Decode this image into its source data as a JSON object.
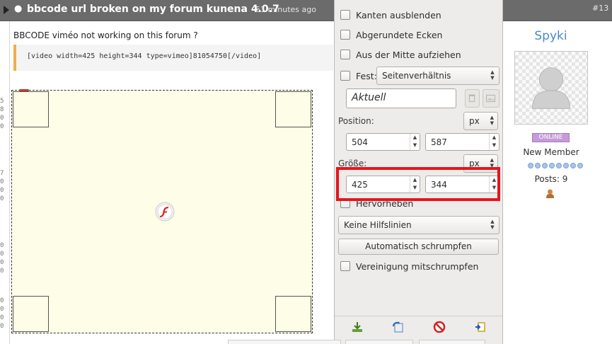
{
  "post": {
    "title": "bbcode url broken on my forum kunena 4.0.7",
    "time": "51 minutes ago",
    "number": "#13",
    "bullet": "●",
    "body": "BBCODE viméo not working on this forum ?",
    "code": "[video width=425 height=344 type=vimeo]81054750[/video]"
  },
  "gutter": {
    "ticks": [
      "5",
      "8",
      "0",
      "0",
      "7",
      "0",
      "0",
      "0",
      "0",
      "0",
      "0",
      "0",
      "0",
      "0",
      "0",
      "0"
    ]
  },
  "flash_box": {
    "close_glyph": "×"
  },
  "panel": {
    "checkboxes": [
      {
        "label": "Kanten ausblenden",
        "checked": false
      },
      {
        "label": "Abgerundete Ecken",
        "checked": false
      },
      {
        "label": "Aus der Mitte aufziehen",
        "checked": false
      }
    ],
    "fixed_label": "Fest:",
    "fixed_select": "Seitenverhältnis",
    "name_value": "Aktuell",
    "position_label": "Position:",
    "position_unit": "px",
    "position_x": "504",
    "position_y": "587",
    "size_label": "Größe:",
    "size_unit": "px",
    "size_w": "425",
    "size_h": "344",
    "highlight_label": "Hervorheben",
    "guides_select": "Keine Hilfslinien",
    "shrink_button": "Automatisch schrumpfen",
    "merge_label": "Vereinigung mitschrumpfen",
    "spin_arrows": "▲▼"
  },
  "user": {
    "name": "Spyki",
    "status": "ONLINE",
    "rank": "New Member",
    "posts": "Posts: 9",
    "rank_dots": 8
  },
  "colors": {
    "header": "#6b6b6b",
    "highlight": "#e8141c",
    "username": "#4c88c8",
    "online_badge": "#c59bd8",
    "code_bar": "#f0ad4e"
  }
}
